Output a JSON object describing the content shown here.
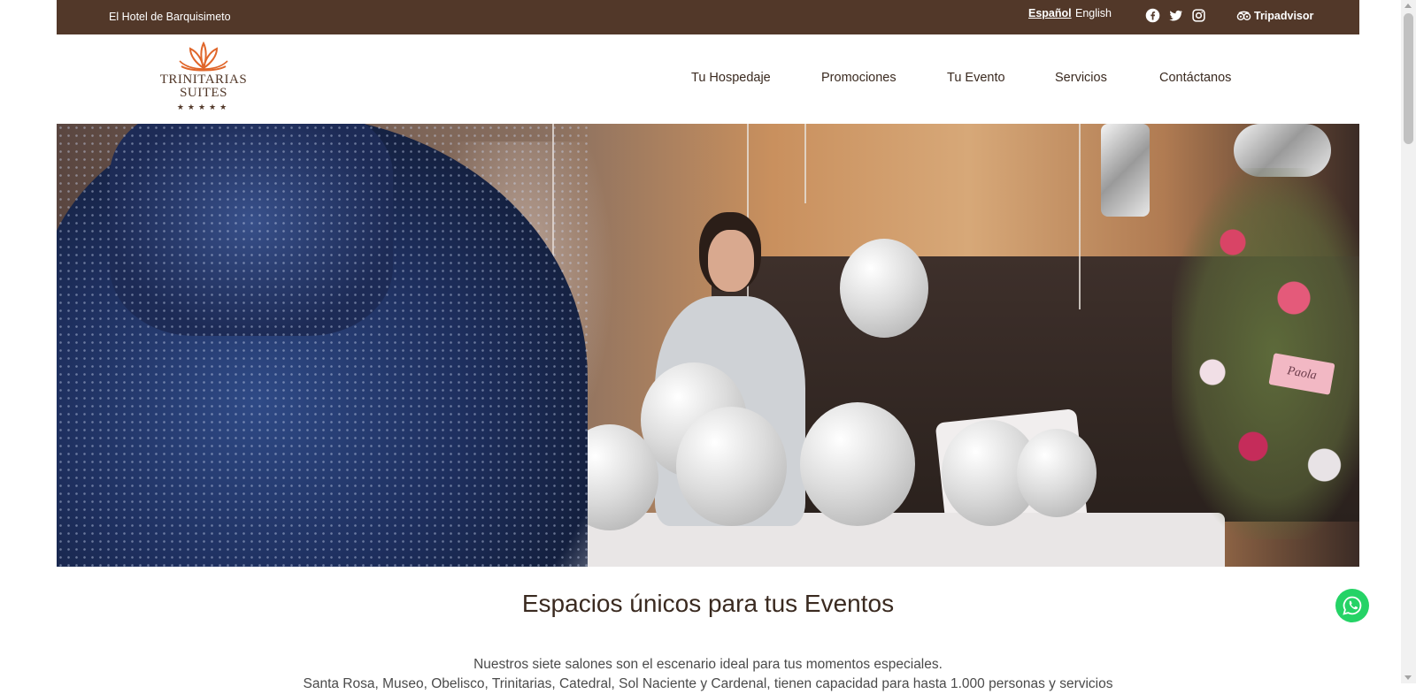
{
  "topbar": {
    "tagline": "El Hotel de Barquisimeto",
    "languages": {
      "es": "Español",
      "en": "English"
    },
    "social_icons": [
      "facebook-icon",
      "twitter-icon",
      "instagram-icon"
    ],
    "tripadvisor": "Tripadvisor",
    "background": "#523829"
  },
  "logo": {
    "line1": "TRINITARIAS",
    "line2": "SUITES",
    "stars": "★★★★★",
    "accent": "#e0662a"
  },
  "nav": {
    "items": [
      "Tu Hospedaje",
      "Promociones",
      "Tu Evento",
      "Servicios",
      "Contáctanos"
    ]
  },
  "hero": {
    "tag_text": "Paola"
  },
  "content": {
    "heading": "Espacios únicos para tus Eventos",
    "paragraph_line1": "Nuestros siete salones son el escenario ideal para tus momentos especiales.",
    "paragraph_line2": "Santa Rosa, Museo, Obelisco, Trinitarias, Catedral, Sol Naciente y Cardenal, tienen capacidad para hasta 1.000 personas y servicios"
  },
  "whatsapp": {
    "icon": "whatsapp-icon",
    "color": "#25d366"
  }
}
